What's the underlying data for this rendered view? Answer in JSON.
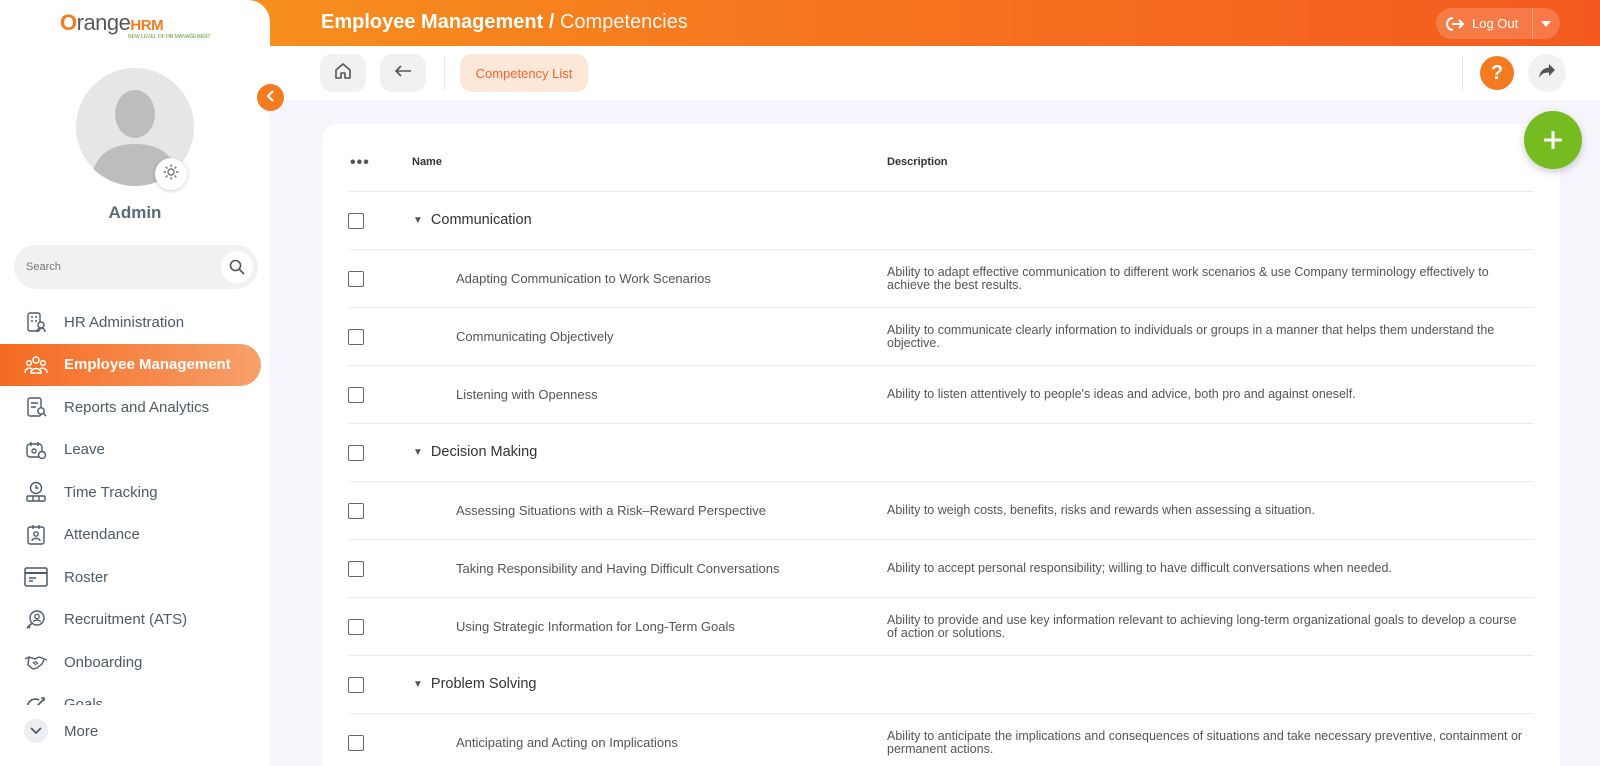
{
  "header": {
    "title_main": "Employee Management /",
    "title_sub": "Competencies",
    "logout_label": "Log Out"
  },
  "toolbar": {
    "competency_list_label": "Competency List",
    "help_label": "?"
  },
  "logo": {
    "brand_prefix": "O",
    "brand_middle": "range",
    "brand_suffix": "HRM",
    "tagline": "NEW LEVEL OF HR MANAGEMENT"
  },
  "sidebar": {
    "user_name": "Admin",
    "search_placeholder": "Search",
    "items": [
      {
        "label": "HR Administration",
        "icon": "hr-admin-icon"
      },
      {
        "label": "Employee Management",
        "icon": "employees-icon",
        "active": true
      },
      {
        "label": "Reports and Analytics",
        "icon": "reports-icon"
      },
      {
        "label": "Leave",
        "icon": "leave-icon"
      },
      {
        "label": "Time Tracking",
        "icon": "time-tracking-icon"
      },
      {
        "label": "Attendance",
        "icon": "attendance-icon"
      },
      {
        "label": "Roster",
        "icon": "roster-icon"
      },
      {
        "label": "Recruitment (ATS)",
        "icon": "recruitment-icon"
      },
      {
        "label": "Onboarding",
        "icon": "onboarding-icon"
      },
      {
        "label": "Goals",
        "icon": "goals-icon"
      }
    ],
    "more_label": "More"
  },
  "table": {
    "columns": [
      "Name",
      "Description"
    ],
    "rows": [
      {
        "type": "group",
        "name": "Communication"
      },
      {
        "type": "item",
        "name": "Adapting Communication to Work Scenarios",
        "description": "Ability to adapt effective communication to different work scenarios & use Company terminology effectively to achieve the best results."
      },
      {
        "type": "item",
        "name": "Communicating Objectively",
        "description": "Ability to communicate clearly information to individuals or groups in a manner that helps them understand the objective."
      },
      {
        "type": "item",
        "name": "Listening with Openness",
        "description": "Ability to listen attentively to people's ideas and advice, both pro and against oneself."
      },
      {
        "type": "group",
        "name": "Decision Making"
      },
      {
        "type": "item",
        "name": "Assessing Situations with a Risk–Reward Perspective",
        "description": "Ability to weigh costs, benefits, risks and rewards when assessing a situation."
      },
      {
        "type": "item",
        "name": "Taking Responsibility and Having Difficult Conversations",
        "description": "Ability to accept personal responsibility; willing to have difficult conversations when needed."
      },
      {
        "type": "item",
        "name": "Using Strategic Information for Long-Term Goals",
        "description": "Ability to provide and use key information relevant to achieving long-term organizational goals to develop a course of action or solutions."
      },
      {
        "type": "group",
        "name": "Problem Solving"
      },
      {
        "type": "item",
        "name": "Anticipating and Acting on Implications",
        "description": "Ability to anticipate the implications and consequences of situations and take necessary preventive, containment or permanent actions."
      }
    ]
  },
  "colors": {
    "brand_orange": "#f47b20",
    "add_green": "#76bc21"
  }
}
